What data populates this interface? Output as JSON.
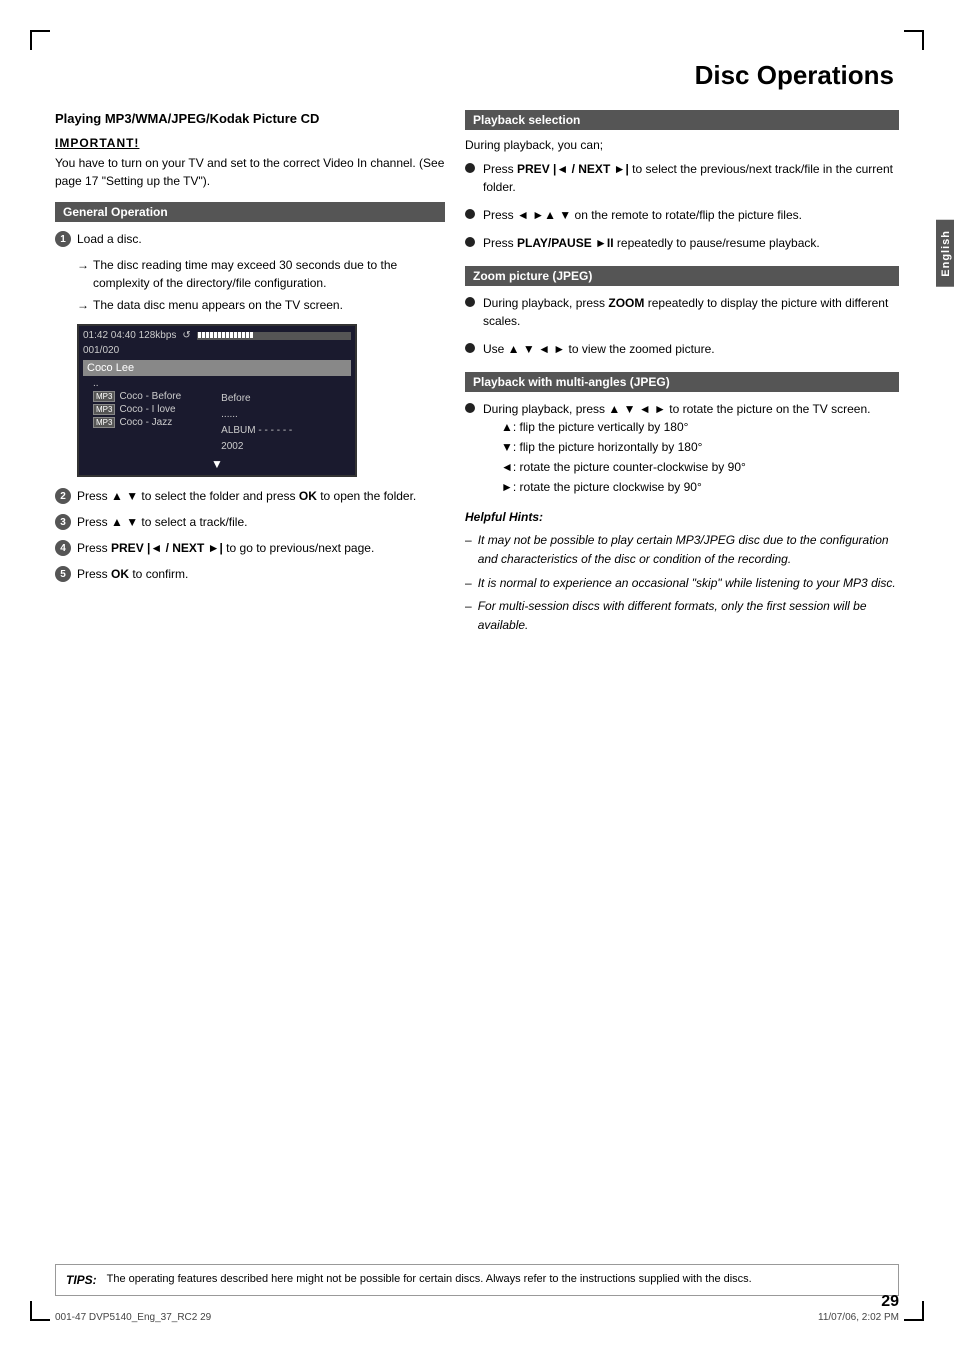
{
  "page": {
    "title": "Disc Operations",
    "page_number": "29",
    "english_tab": "English"
  },
  "footer": {
    "left": "001-47 DVP5140_Eng_37_RC2        29",
    "right": "11/07/06, 2:02 PM"
  },
  "tips": {
    "label": "TIPS:",
    "text": "The operating features described here might not be possible for certain discs.  Always refer to the instructions supplied with the discs."
  },
  "left_column": {
    "section_title": "Playing MP3/WMA/JPEG/Kodak Picture CD",
    "important_label": "IMPORTANT!",
    "important_text": "You have to turn on your TV and set to the correct Video In channel.  (See page 17 \"Setting up the TV\").",
    "general_operation_header": "General Operation",
    "steps": [
      {
        "number": "1",
        "text": "Load a disc.",
        "notes": [
          "The disc reading time may exceed 30 seconds due to the complexity of the directory/file configuration.",
          "The data disc menu appears on the TV screen."
        ]
      },
      {
        "number": "2",
        "text_before": "Press ▲ ▼ to select the folder and press ",
        "bold": "OK",
        "text_after": " to open the folder."
      },
      {
        "number": "3",
        "text_before": "Press ▲ ▼ to select a track/file."
      },
      {
        "number": "4",
        "text_before": "Press  ",
        "bold": "PREV |◄ / NEXT ►|",
        "text_after": " to go to previous/next page."
      },
      {
        "number": "5",
        "text_before": "Press ",
        "bold": "OK",
        "text_after": " to confirm."
      }
    ],
    "screen": {
      "time": "01:42  04:40  128kbps",
      "track": "001/020",
      "highlighted": "Coco Lee",
      "files": [
        {
          "label": "..",
          "badge": ""
        },
        {
          "label": "Coco - Before",
          "badge": "MP3"
        },
        {
          "label": "Coco - I love",
          "badge": "MP3"
        },
        {
          "label": "Coco - Jazz",
          "badge": "MP3"
        }
      ],
      "right_labels": [
        "Before",
        "......",
        "ALBUM------",
        "2002"
      ]
    }
  },
  "right_column": {
    "playback_selection": {
      "header": "Playback selection",
      "intro": "During playback, you can;",
      "bullets": [
        {
          "text_before": "Press  ",
          "bold1": "PREV |◄ / NEXT ►|",
          "text_after": " to select the previous/next track/file in the current folder."
        },
        {
          "text_before": "Press ◄ ►▲ ▼ on the remote to rotate/flip the picture files."
        },
        {
          "text_before": "Press ",
          "bold1": "PLAY/PAUSE ►II",
          "text_after": " repeatedly to pause/resume playback."
        }
      ]
    },
    "zoom_picture": {
      "header": "Zoom picture (JPEG)",
      "bullets": [
        {
          "text_before": "During playback, press ",
          "bold1": "ZOOM",
          "text_after": " repeatedly to display the picture with different scales."
        },
        {
          "text_before": "Use ▲ ▼ ◄ ► to view the zoomed picture."
        }
      ]
    },
    "multi_angles": {
      "header": "Playback with multi-angles (JPEG)",
      "bullets": [
        {
          "text_before": "During playback, press ▲ ▼ ◄ ► to rotate the picture on the TV screen.",
          "sub_bullets": [
            "▲: flip the picture vertically by 180°",
            "▼: flip the picture horizontally by 180°",
            "◄: rotate the picture counter-clockwise by 90°",
            "►: rotate the picture clockwise by 90°"
          ]
        }
      ],
      "helpful_hints_title": "Helpful Hints:",
      "hints": [
        "It may not be possible to play certain MP3/JPEG disc due to the configuration and characteristics of the disc or condition of the recording.",
        "It is normal to experience an occasional \"skip\" while listening to your MP3 disc.",
        "For multi-session discs with different formats, only the first session will be available."
      ]
    }
  }
}
